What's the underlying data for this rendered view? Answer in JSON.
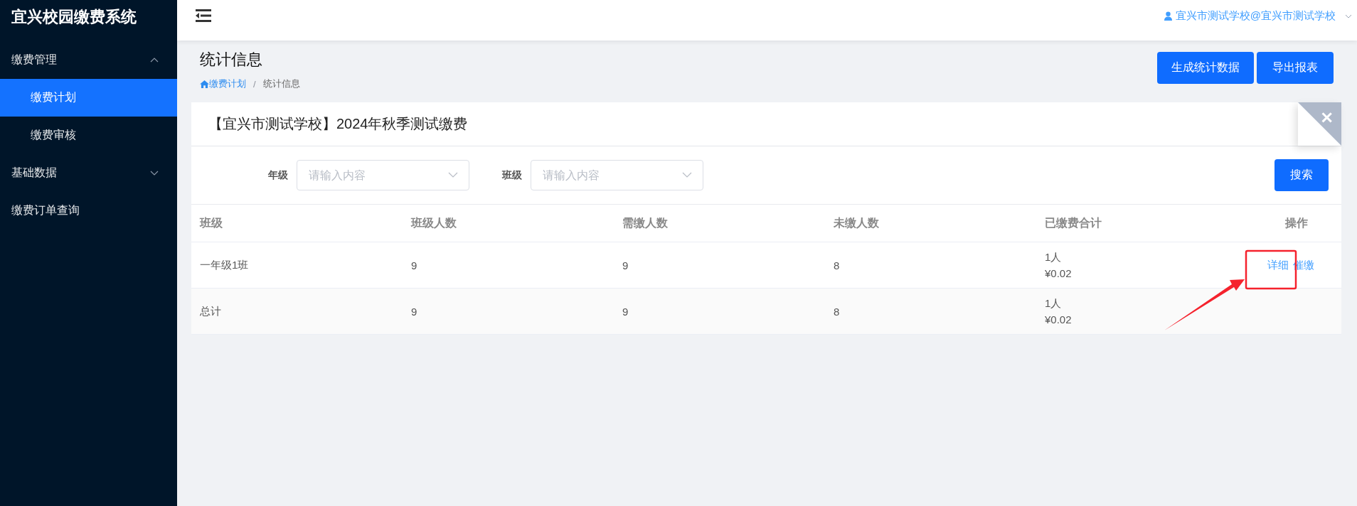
{
  "sidebar": {
    "title": "宜兴校园缴费系统",
    "menu": [
      {
        "label": "缴费管理",
        "kind": "group",
        "expanded": true,
        "children": [
          {
            "label": "缴费计划",
            "selected": true
          },
          {
            "label": "缴费审核",
            "selected": false
          }
        ]
      },
      {
        "label": "基础数据",
        "kind": "group",
        "expanded": false
      },
      {
        "label": "缴费订单查询",
        "kind": "item",
        "selected": false
      }
    ]
  },
  "header": {
    "user": "宜兴市测试学校@宜兴市测试学校"
  },
  "page": {
    "title": "统计信息",
    "breadcrumb": [
      "缴费计划",
      "统计信息"
    ],
    "breadcrumb_separator": "/",
    "buttons": [
      "生成统计数据",
      "导出报表"
    ]
  },
  "card": {
    "title": "【宜兴市测试学校】2024年秋季测试缴费",
    "filters": [
      {
        "label": "年级",
        "placeholder": "请输入内容"
      },
      {
        "label": "班级",
        "placeholder": "请输入内容"
      }
    ],
    "search_button": "搜索",
    "table": {
      "columns": [
        "班级",
        "班级人数",
        "需缴人数",
        "未缴人数",
        "已缴费合计",
        "操作"
      ],
      "rows": [
        {
          "class": "一年级1班",
          "size": "9",
          "due": "9",
          "unpaid": "8",
          "paid_count": "1人",
          "paid_amount": "¥0.02",
          "actions": [
            "详细",
            "催缴"
          ]
        },
        {
          "class": "总计",
          "size": "9",
          "due": "9",
          "unpaid": "8",
          "paid_count": "1人",
          "paid_amount": "¥0.02"
        }
      ]
    }
  },
  "annotations": [
    {
      "kind": "box"
    },
    {
      "kind": "arrow"
    }
  ]
}
